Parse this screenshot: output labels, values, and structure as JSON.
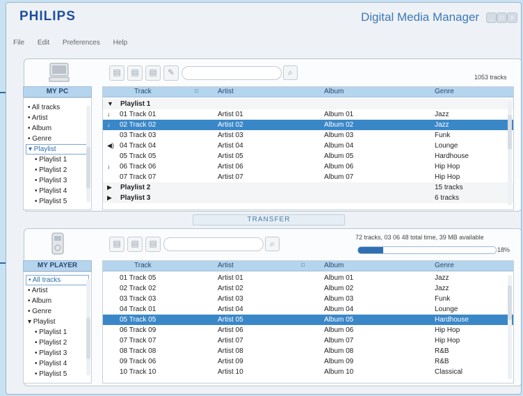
{
  "app": {
    "brand": "PHILIPS",
    "title": "Digital Media Manager",
    "window_controls": [
      "_",
      "□",
      "×"
    ]
  },
  "menu": [
    "File",
    "Edit",
    "Preferences",
    "Help"
  ],
  "transfer_label": "TRANSFER",
  "pc": {
    "header": "MY PC",
    "track_count": "1053 tracks",
    "sidebar": [
      {
        "label": "• All tracks",
        "indent": 0,
        "selected": false
      },
      {
        "label": "• Artist",
        "indent": 0,
        "selected": false
      },
      {
        "label": "• Album",
        "indent": 0,
        "selected": false
      },
      {
        "label": "• Genre",
        "indent": 0,
        "selected": false
      },
      {
        "label": "▾ Playlist",
        "indent": 0,
        "selected": true
      },
      {
        "label": "• Playlist 1",
        "indent": 1,
        "selected": false
      },
      {
        "label": "• Playlist 2",
        "indent": 1,
        "selected": false
      },
      {
        "label": "• Playlist 3",
        "indent": 1,
        "selected": false
      },
      {
        "label": "• Playlist 4",
        "indent": 1,
        "selected": false
      },
      {
        "label": "• Playlist 5",
        "indent": 1,
        "selected": false
      }
    ],
    "columns": {
      "track": "Track",
      "sort_marker": "□",
      "artist": "Artist",
      "album": "Album",
      "genre": "Genre"
    },
    "rows": [
      {
        "type": "group",
        "marker": "▼",
        "track": "Playlist 1",
        "artist": "",
        "album": "",
        "genre": ""
      },
      {
        "type": "row",
        "marker": "↓",
        "track": "01  Track 01",
        "artist": "Artist 01",
        "album": "Album 01",
        "genre": "Jazz",
        "selected": false
      },
      {
        "type": "row",
        "marker": "↓",
        "track": "02  Track 02",
        "artist": "Artist 02",
        "album": "Album 02",
        "genre": "Jazz",
        "selected": true
      },
      {
        "type": "row",
        "marker": "",
        "track": "03  Track 03",
        "artist": "Artist 03",
        "album": "Album 03",
        "genre": "Funk",
        "selected": false
      },
      {
        "type": "row",
        "marker": "◀)",
        "track": "04  Track 04",
        "artist": "Artist 04",
        "album": "Album 04",
        "genre": "Lounge",
        "selected": false
      },
      {
        "type": "row",
        "marker": "",
        "track": "05  Track 05",
        "artist": "Artist 05",
        "album": "Album 05",
        "genre": "Hardhouse",
        "selected": false
      },
      {
        "type": "row",
        "marker": "↓",
        "track": "06  Track 06",
        "artist": "Artist 06",
        "album": "Album 06",
        "genre": "Hip Hop",
        "selected": false
      },
      {
        "type": "row",
        "marker": "",
        "track": "07  Track 07",
        "artist": "Artist 07",
        "album": "Album 07",
        "genre": "Hip Hop",
        "selected": false
      },
      {
        "type": "group",
        "marker": "▶",
        "track": "Playlist 2",
        "artist": "",
        "album": "",
        "genre": "15 tracks"
      },
      {
        "type": "group",
        "marker": "▶",
        "track": "Playlist 3",
        "artist": "",
        "album": "",
        "genre": "6 tracks"
      }
    ]
  },
  "player": {
    "header": "MY PLAYER",
    "status": "72 tracks, 03 06 48 total time, 39 MB available",
    "capacity_percent": 18,
    "capacity_label": "18%",
    "sidebar": [
      {
        "label": "• All tracks",
        "indent": 0,
        "selected": true
      },
      {
        "label": "• Artist",
        "indent": 0,
        "selected": false
      },
      {
        "label": "• Album",
        "indent": 0,
        "selected": false
      },
      {
        "label": "• Genre",
        "indent": 0,
        "selected": false
      },
      {
        "label": "▾ Playlist",
        "indent": 0,
        "selected": false
      },
      {
        "label": "• Playlist 1",
        "indent": 1,
        "selected": false
      },
      {
        "label": "• Playlist 2",
        "indent": 1,
        "selected": false
      },
      {
        "label": "• Playlist 3",
        "indent": 1,
        "selected": false
      },
      {
        "label": "• Playlist 4",
        "indent": 1,
        "selected": false
      },
      {
        "label": "• Playlist 5",
        "indent": 1,
        "selected": false
      }
    ],
    "columns": {
      "track": "Track",
      "sort_marker": "□",
      "artist": "Artist",
      "album": "Album",
      "genre": "Genre"
    },
    "rows": [
      {
        "type": "row",
        "marker": "",
        "track": "01  Track 05",
        "artist": "Artist 01",
        "album": "Album 01",
        "genre": "Jazz",
        "selected": false
      },
      {
        "type": "row",
        "marker": "",
        "track": "02  Track 02",
        "artist": "Artist 02",
        "album": "Album 02",
        "genre": "Jazz",
        "selected": false
      },
      {
        "type": "row",
        "marker": "",
        "track": "03  Track 03",
        "artist": "Artist 03",
        "album": "Album 03",
        "genre": "Funk",
        "selected": false
      },
      {
        "type": "row",
        "marker": "",
        "track": "04  Track 01",
        "artist": "Artist 04",
        "album": "Album 04",
        "genre": "Lounge",
        "selected": false
      },
      {
        "type": "row",
        "marker": "",
        "track": "05  Track 05",
        "artist": "Artist 05",
        "album": "Album 05",
        "genre": "Hardhouse",
        "selected": true
      },
      {
        "type": "row",
        "marker": "",
        "track": "06  Track 09",
        "artist": "Artist 06",
        "album": "Album 06",
        "genre": "Hip Hop",
        "selected": false
      },
      {
        "type": "row",
        "marker": "",
        "track": "07  Track 07",
        "artist": "Artist 07",
        "album": "Album 07",
        "genre": "Hip Hop",
        "selected": false
      },
      {
        "type": "row",
        "marker": "",
        "track": "08  Track 08",
        "artist": "Artist 08",
        "album": "Album 08",
        "genre": "R&B",
        "selected": false
      },
      {
        "type": "row",
        "marker": "",
        "track": "09  Track 06",
        "artist": "Artist 09",
        "album": "Album 09",
        "genre": "R&B",
        "selected": false
      },
      {
        "type": "row",
        "marker": "",
        "track": "10  Track 10",
        "artist": "Artist 10",
        "album": "Album 10",
        "genre": "Classical",
        "selected": false
      }
    ]
  }
}
